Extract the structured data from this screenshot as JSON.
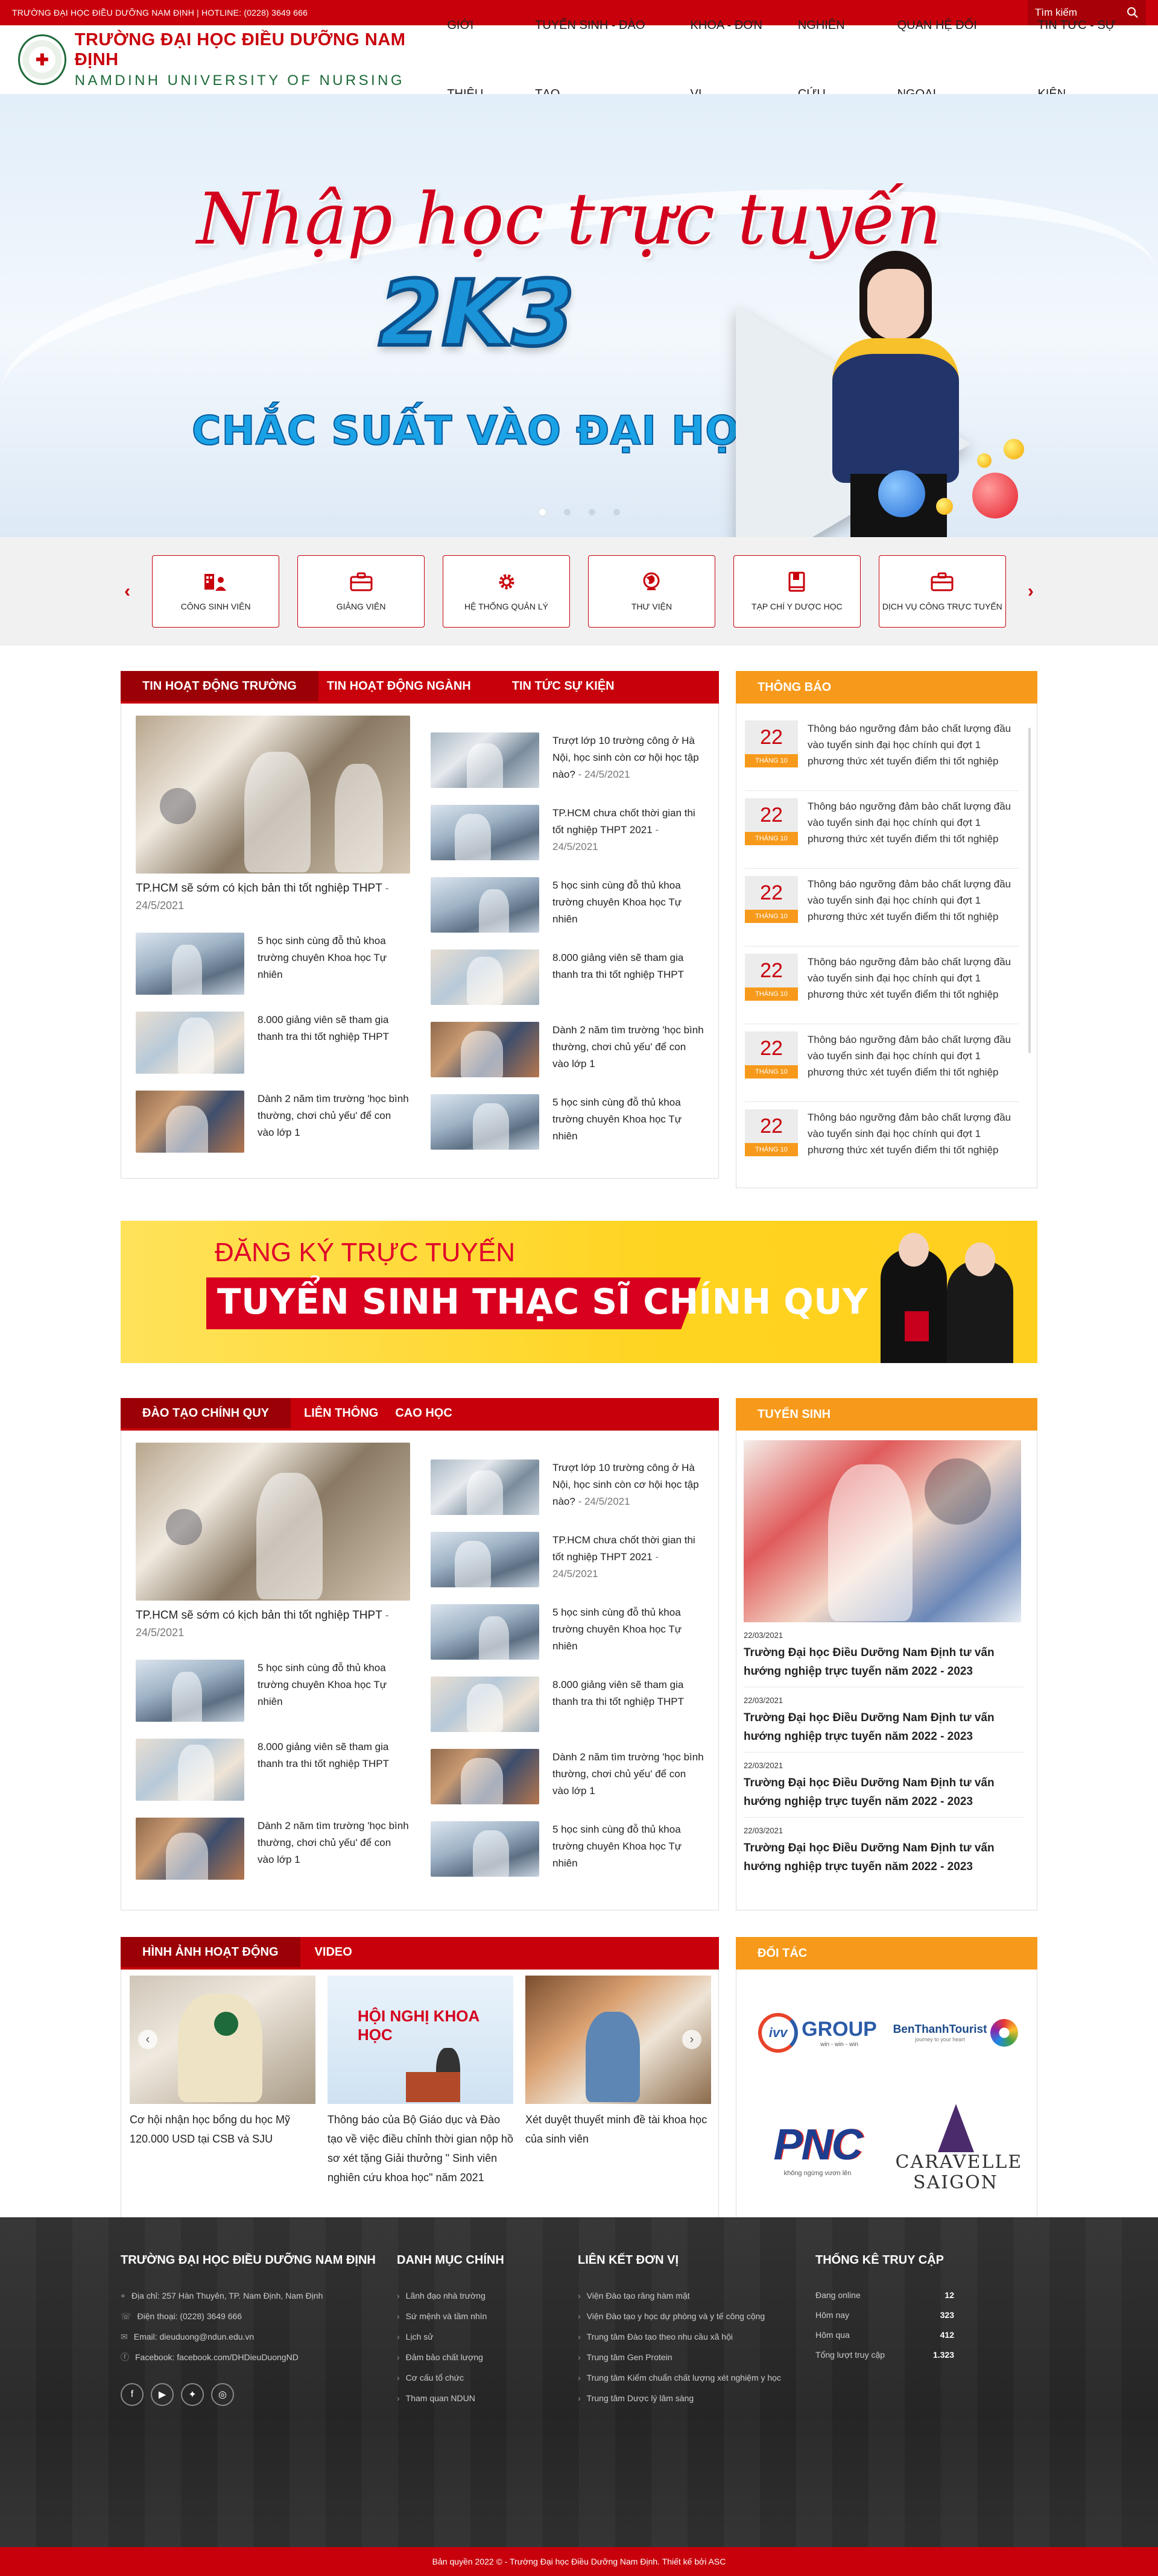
{
  "topbar": {
    "info": "TRƯỜNG ĐẠI HỌC ĐIỀU DƯỠNG NAM ĐỊNH | HOTLINE: (0228) 3649 666",
    "search_placeholder": "Tìm kiếm"
  },
  "header": {
    "logo_title": "TRƯỜNG ĐẠI HỌC ĐIỀU DƯỠNG NAM ĐỊNH",
    "logo_sub": "NAMDINH UNIVERSITY OF NURSING",
    "nav": [
      "GIỚI THIỆU",
      "TUYỂN SINH - ĐÀO TẠO",
      "KHOA - ĐƠN VỊ",
      "NGHIÊN CỨU",
      "QUAN HỆ ĐỐI NGOẠI",
      "TIN TỨC - SỰ KIỆN"
    ]
  },
  "banner": {
    "title": "Nhập học trực tuyến",
    "big": "2K3",
    "sub": "CHẮC SUẤT VÀO ĐẠI HỌC",
    "slides": 4,
    "active_slide": 1
  },
  "quick_links": [
    {
      "label": "CÔNG SINH VIÊN",
      "icon": "people-icon"
    },
    {
      "label": "GIẢNG VIÊN",
      "icon": "briefcase-icon"
    },
    {
      "label": "HỆ THỐNG QUẢN LÝ",
      "icon": "gear-icon"
    },
    {
      "label": "THƯ VIỆN",
      "icon": "globe-icon"
    },
    {
      "label": "TẠP CHÍ Y DƯỢC HỌC",
      "icon": "book-icon"
    },
    {
      "label": "DỊCH VỤ CÔNG TRỰC TUYẾN",
      "icon": "briefcase-icon"
    }
  ],
  "news1": {
    "tabs": [
      "TIN HOẠT ĐỘNG TRƯỜNG",
      "TIN HOẠT ĐỘNG NGÀNH",
      "TIN TỨC SỰ KIỆN"
    ],
    "featured": {
      "title": "TP.HCM sẽ sớm có kịch bản thi tốt nghiệp THPT",
      "date": "24/5/2021"
    },
    "left_items": [
      {
        "title": "5 học sinh cùng đỗ thủ khoa trường chuyên Khoa học Tự nhiên"
      },
      {
        "title": "8.000 giảng viên sẽ tham gia thanh tra thi tốt nghiệp THPT"
      },
      {
        "title": "Dành 2 năm tìm trường 'học bình thường, chơi chủ yếu' để con vào lớp 1"
      }
    ],
    "right_items": [
      {
        "title": "Trượt lớp 10 trường công ở Hà Nội, học sinh còn cơ hội học tập nào?",
        "date": "24/5/2021"
      },
      {
        "title": "TP.HCM chưa chốt thời gian thi tốt nghiệp THPT 2021",
        "date": "24/5/2021"
      },
      {
        "title": "5 học sinh cùng đỗ thủ khoa trường chuyên Khoa học Tự nhiên"
      },
      {
        "title": "8.000 giảng viên sẽ tham gia thanh tra thi tốt nghiệp THPT"
      },
      {
        "title": "Dành 2 năm tìm trường 'học bình thường, chơi chủ yếu' để con vào lớp 1"
      },
      {
        "title": "5 học sinh cùng đỗ thủ khoa trường chuyên Khoa học Tự nhiên"
      }
    ]
  },
  "notices": {
    "title": "THÔNG BÁO",
    "items": [
      {
        "day": "22",
        "month": "THÁNG 10",
        "text": "Thông báo ngưỡng đảm bảo chất lượng đầu vào tuyển sinh đại học chính qui đợt 1 phương thức xét tuyển điểm thi tốt nghiệp"
      },
      {
        "day": "22",
        "month": "THÁNG 10",
        "text": "Thông báo ngưỡng đảm bảo chất lượng đầu vào tuyển sinh đại học chính qui đợt 1 phương thức xét tuyển điểm thi tốt nghiệp"
      },
      {
        "day": "22",
        "month": "THÁNG 10",
        "text": "Thông báo ngưỡng đảm bảo chất lượng đầu vào tuyển sinh đại học chính qui đợt 1 phương thức xét tuyển điểm thi tốt nghiệp"
      },
      {
        "day": "22",
        "month": "THÁNG 10",
        "text": "Thông báo ngưỡng đảm bảo chất lượng đầu vào tuyển sinh đại học chính qui đợt 1 phương thức xét tuyển điểm thi tốt nghiệp"
      },
      {
        "day": "22",
        "month": "THÁNG 10",
        "text": "Thông báo ngưỡng đảm bảo chất lượng đầu vào tuyển sinh đại học chính qui đợt 1 phương thức xét tuyển điểm thi tốt nghiệp"
      },
      {
        "day": "22",
        "month": "THÁNG 10",
        "text": "Thông báo ngưỡng đảm bảo chất lượng đầu vào tuyển sinh đại học chính qui đợt 1 phương thức xét tuyển điểm thi tốt nghiệp"
      }
    ]
  },
  "ad": {
    "line1": "ĐĂNG KÝ TRỰC TUYẾN",
    "line2": "TUYỂN SINH THẠC SĨ CHÍNH QUY"
  },
  "news2": {
    "tabs": [
      "ĐÀO TẠO CHÍNH QUY",
      "LIÊN THÔNG",
      "CAO HỌC"
    ],
    "featured": {
      "title": "TP.HCM sẽ sớm có kịch bản thi tốt nghiệp THPT",
      "date": "24/5/2021"
    },
    "left_items": [
      {
        "title": "5 học sinh cùng đỗ thủ khoa trường chuyên Khoa học Tự nhiên"
      },
      {
        "title": "8.000 giảng viên sẽ tham gia thanh tra thi tốt nghiệp THPT"
      },
      {
        "title": "Dành 2 năm tìm trường 'học bình thường, chơi chủ yếu' để con vào lớp 1"
      }
    ],
    "right_items": [
      {
        "title": "Trượt lớp 10 trường công ở Hà Nội, học sinh còn cơ hội học tập nào?",
        "date": "24/5/2021"
      },
      {
        "title": "TP.HCM chưa chốt thời gian thi tốt nghiệp THPT 2021",
        "date": "24/5/2021"
      },
      {
        "title": "5 học sinh cùng đỗ thủ khoa trường chuyên Khoa học Tự nhiên"
      },
      {
        "title": "8.000 giảng viên sẽ tham gia thanh tra thi tốt nghiệp THPT"
      },
      {
        "title": "Dành 2 năm tìm trường 'học bình thường, chơi chủ yếu' để con vào lớp 1"
      },
      {
        "title": "5 học sinh cùng đỗ thủ khoa trường chuyên Khoa học Tự nhiên"
      }
    ]
  },
  "tuyensinh": {
    "title": "TUYỂN SINH",
    "items": [
      {
        "date": "22/03/2021",
        "title": "Trường Đại học Điều Dưỡng Nam Định tư vấn hướng nghiệp trực tuyến năm 2022 - 2023"
      },
      {
        "date": "22/03/2021",
        "title": "Trường Đại học Điều Dưỡng Nam Định tư vấn hướng nghiệp trực tuyến năm 2022 - 2023"
      },
      {
        "date": "22/03/2021",
        "title": "Trường Đại học Điều Dưỡng Nam Định tư vấn hướng nghiệp trực tuyến năm 2022 - 2023"
      },
      {
        "date": "22/03/2021",
        "title": "Trường Đại học Điều Dưỡng Nam Định tư vấn hướng nghiệp trực tuyến năm 2022 - 2023"
      }
    ]
  },
  "gallery": {
    "tabs": [
      "HÌNH ẢNH HOẠT ĐỘNG",
      "VIDEO"
    ],
    "items": [
      {
        "caption": "Cơ hội nhận học bổng du học Mỹ 120.000 USD tại CSB và SJU"
      },
      {
        "caption": "Thông báo của Bộ Giáo dục và Đào tạo về việc điều chỉnh thời gian nộp hồ sơ xét tặng Giải thưởng \" Sinh viên nghiên cứu khoa học\" năm 2021"
      },
      {
        "caption": "Xét duyệt thuyết minh đề tài khoa học của sinh viên"
      }
    ],
    "overlay_text": "HỘI NGHỊ KHOA HỌC"
  },
  "partners": {
    "title": "ĐỐI TÁC",
    "items": [
      "GROUP",
      "BenThanhTourist",
      "PNC",
      "CARAVELLE SAIGON"
    ],
    "sub": {
      "ivv": "win - win - win",
      "ben": "journey to your heart",
      "pnc": "không ngừng vươn lên"
    }
  },
  "footer": {
    "col1": {
      "title": "TRƯỜNG ĐẠI HỌC ĐIỀU DƯỠNG NAM ĐỊNH",
      "lines": [
        "Địa chỉ: 257 Hàn Thuyên, TP. Nam Định, Nam Định",
        "Điện thoại: (0228) 3649 666",
        "Email: dieuduong@ndun.edu.vn",
        "Facebook: facebook.com/DHDieuDuongND"
      ]
    },
    "col2": {
      "title": "DANH MỤC CHÍNH",
      "lines": [
        "Lãnh đạo nhà trường",
        "Sứ mệnh và tầm nhìn",
        "Lịch sử",
        "Đảm bảo chất lượng",
        "Cơ cấu tổ chức",
        "Tham quan NDUN"
      ]
    },
    "col3": {
      "title": "LIÊN KẾT ĐƠN VỊ",
      "lines": [
        "Viện Đào tạo răng hàm mặt",
        "Viện Đào tạo y học dự phòng và y tế công cộng",
        "Trung tâm Đào tạo theo nhu cầu xã hội",
        "Trung tâm Gen Protein",
        "Trung tâm Kiểm chuẩn chất lượng xét nghiệm y học",
        "Trung tâm Dược lý lâm sàng"
      ]
    },
    "col4": {
      "title": "THỐNG KÊ TRUY CẬP",
      "stats": [
        {
          "label": "Đang online",
          "value": "12"
        },
        {
          "label": "Hôm nay",
          "value": "323"
        },
        {
          "label": "Hôm qua",
          "value": "412"
        },
        {
          "label": "Tổng lượt truy cập",
          "value": "1.323"
        }
      ]
    },
    "copyright": "Bản quyền 2022 © - Trường Đại học Điều Dưỡng Nam Định. Thiết kế bởi ASC"
  }
}
